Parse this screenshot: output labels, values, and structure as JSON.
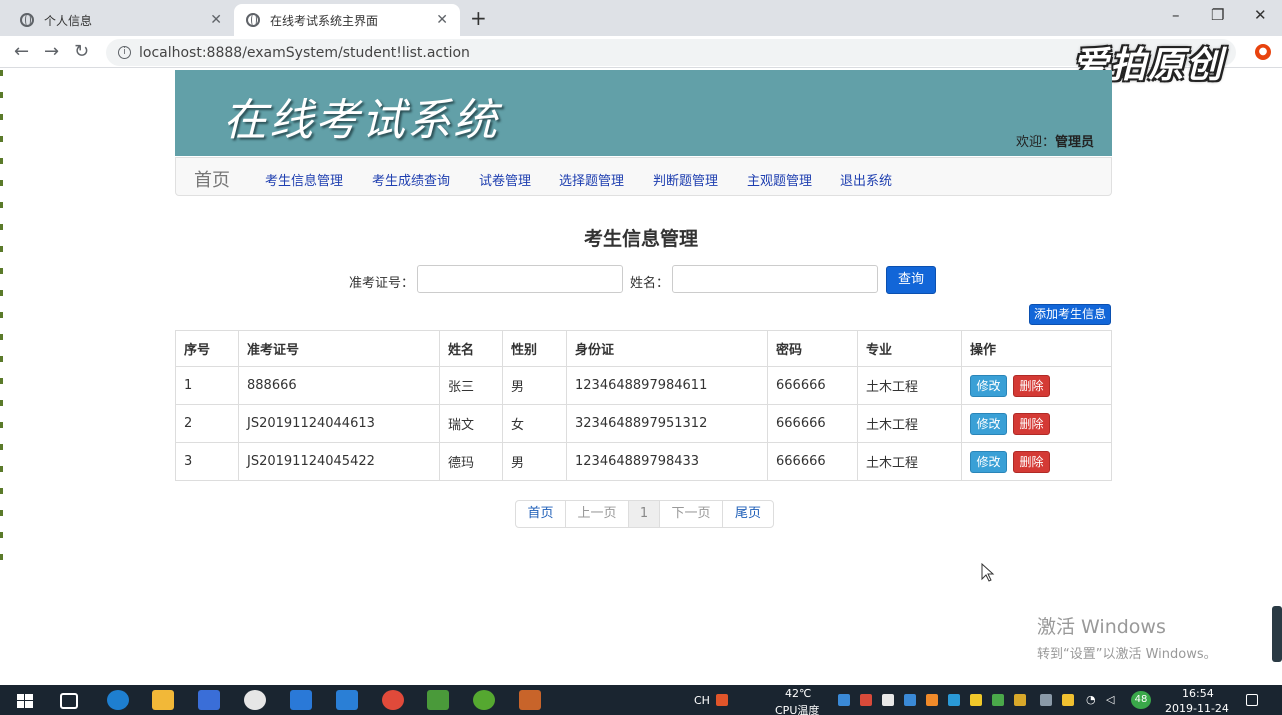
{
  "browser": {
    "tabs": [
      {
        "title": "个人信息",
        "active": false
      },
      {
        "title": "在线考试系统主界面",
        "active": true
      }
    ],
    "new_tab": "+",
    "url": "localhost:8888/examSystem/student!list.action",
    "controls": {
      "minimize": "–",
      "maximize": "❐",
      "close": "✕"
    },
    "nav": {
      "back": "←",
      "forward": "→",
      "reload": "↻"
    },
    "info": "i"
  },
  "watermark": "爱拍原创",
  "header": {
    "title": "在线考试系统",
    "welcome_prefix": "欢迎：",
    "welcome_user": "管理员",
    "banner_color": "#62a0a8"
  },
  "navbar": {
    "brand": "首页",
    "items": [
      "考生信息管理",
      "考生成绩查询",
      "试卷管理",
      "选择题管理",
      "判断题管理",
      "主观题管理",
      "退出系统"
    ]
  },
  "page": {
    "heading": "考生信息管理",
    "search": {
      "id_label": "准考证号：",
      "name_label": "姓名：",
      "id_value": "",
      "name_value": "",
      "query_button": "查询"
    },
    "add_button": "添加考生信息",
    "table": {
      "columns": [
        "序号",
        "准考证号",
        "姓名",
        "性别",
        "身份证",
        "密码",
        "专业",
        "操作"
      ],
      "rows": [
        [
          "1",
          "888666",
          "张三",
          "男",
          "1234648897984611",
          "666666",
          "土木工程"
        ],
        [
          "2",
          "JS20191124044613",
          "瑞文",
          "女",
          "3234648897951312",
          "666666",
          "土木工程"
        ],
        [
          "3",
          "JS20191124045422",
          "德玛",
          "男",
          "123464889798433",
          "666666",
          "土木工程"
        ]
      ],
      "edit_label": "修改",
      "delete_label": "删除"
    },
    "pager": {
      "first": "首页",
      "prev": "上一页",
      "current": "1",
      "next": "下一页",
      "last": "尾页"
    }
  },
  "activation": {
    "line1": "激活 Windows",
    "line2": "转到“设置”以激活 Windows。"
  },
  "taskbar": {
    "ime": "CH",
    "temp": "42℃",
    "temp_label": "CPU温度",
    "clock": "16:54",
    "date": "2019-11-24",
    "badge": "48"
  },
  "colors": {
    "primary": "#1266d8",
    "edit": "#3aa0d6",
    "delete": "#d43a35",
    "link": "#1f3fb0"
  }
}
